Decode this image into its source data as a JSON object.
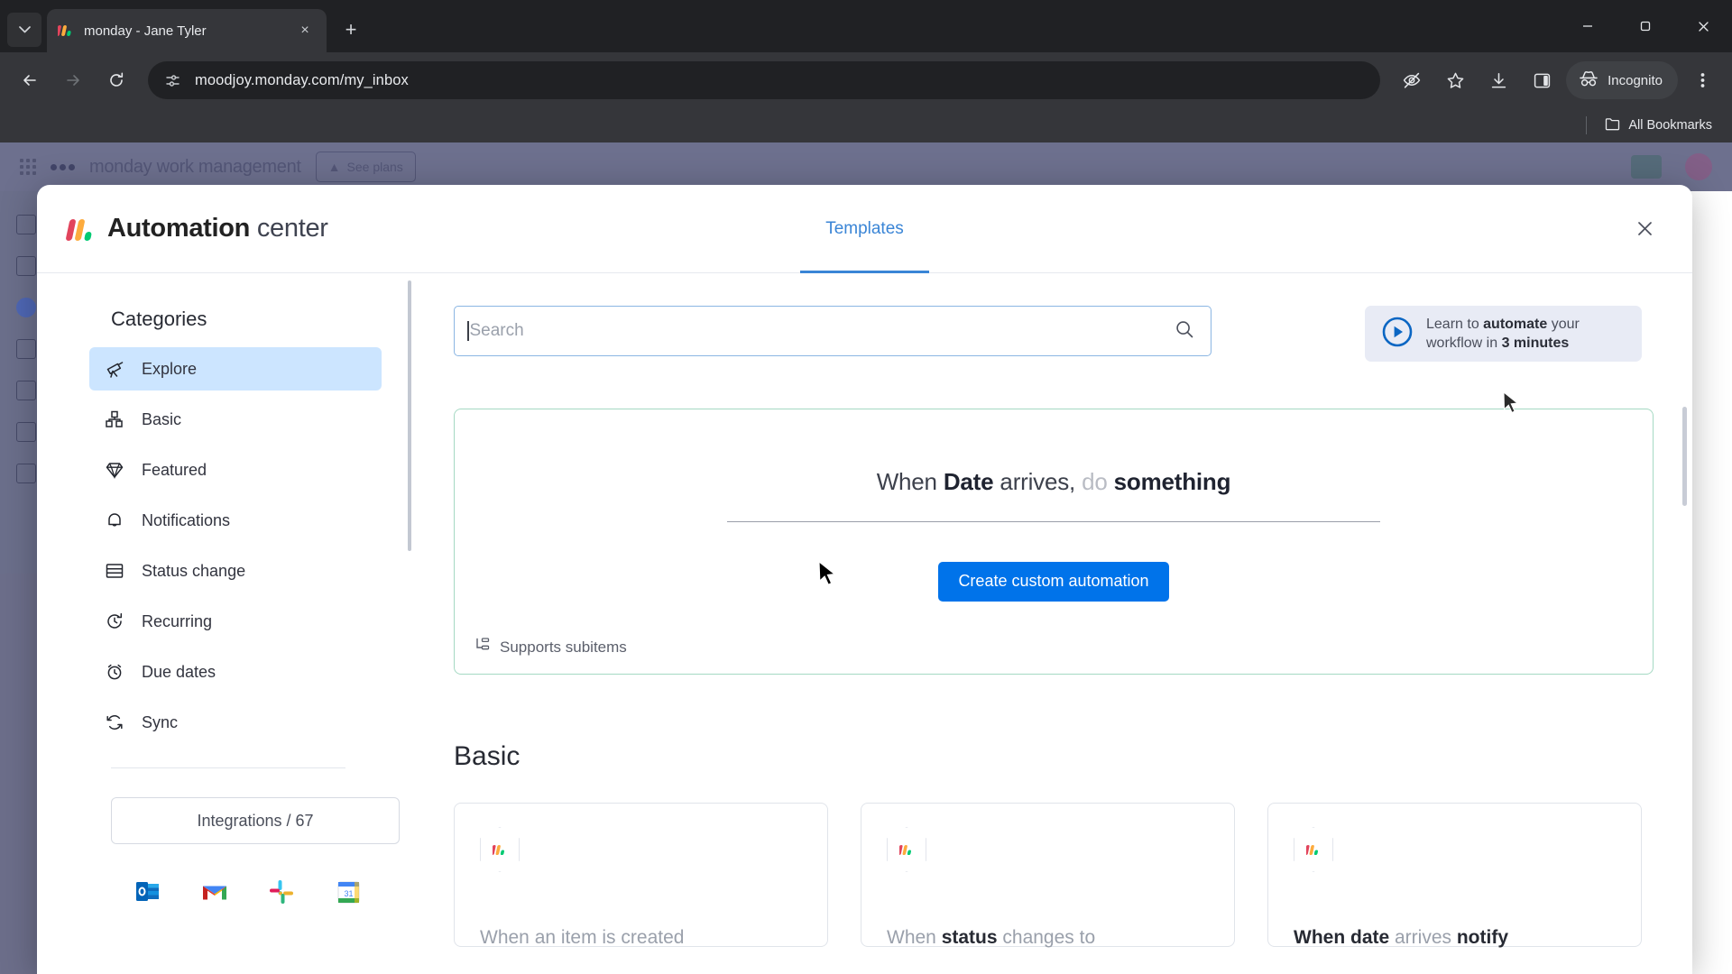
{
  "browser": {
    "tab": {
      "title": "monday - Jane Tyler",
      "favicon": "monday-logo-icon"
    },
    "tab_search_icon": "chevron-down-icon",
    "new_tab_label": "+",
    "close_tab_label": "×",
    "window": {
      "minimize": "–",
      "maximize": "❐",
      "close": "✕"
    },
    "nav": {
      "back": "←",
      "forward": "→",
      "reload": "↻"
    },
    "omnibox": {
      "url": "moodjoy.monday.com/my_inbox",
      "site_info_icon": "site-settings-icon"
    },
    "actions": {
      "tracking_protection": "eye-off-icon",
      "bookmark": "star-icon",
      "downloads": "download-icon",
      "side_panel": "side-panel-icon",
      "profile_label": "Incognito",
      "menu": "three-dot-menu-icon"
    },
    "bookmarks_bar": {
      "all_bookmarks": "All Bookmarks",
      "folder_icon": "folder-icon"
    }
  },
  "page_behind": {
    "brand": "monday",
    "brand_suffix": "work management",
    "see_plans": "See plans",
    "see_plans_icon": "rocket-icon"
  },
  "modal": {
    "brand_title": "Automation",
    "brand_subtitle": "center",
    "close_label": "✕",
    "tabs": [
      {
        "label": "Templates",
        "active": true
      }
    ]
  },
  "sidebar": {
    "title": "Categories",
    "items": [
      {
        "label": "Explore",
        "icon": "telescope-icon",
        "active": true
      },
      {
        "label": "Basic",
        "icon": "blocks-icon",
        "active": false
      },
      {
        "label": "Featured",
        "icon": "diamond-icon",
        "active": false
      },
      {
        "label": "Notifications",
        "icon": "bell-icon",
        "active": false
      },
      {
        "label": "Status change",
        "icon": "rows-icon",
        "active": false
      },
      {
        "label": "Recurring",
        "icon": "refresh-clock-icon",
        "active": false
      },
      {
        "label": "Due dates",
        "icon": "alarm-clock-icon",
        "active": false
      },
      {
        "label": "Sync",
        "icon": "sync-icon",
        "active": false
      }
    ],
    "integrations_label": "Integrations / 67",
    "apps": [
      {
        "name": "outlook-icon"
      },
      {
        "name": "gmail-icon"
      },
      {
        "name": "slack-icon"
      },
      {
        "name": "google-calendar-icon"
      }
    ]
  },
  "content": {
    "search": {
      "placeholder": "Search",
      "value": "",
      "icon": "search-icon"
    },
    "learn_banner": {
      "line1_pre": "Learn to ",
      "line1_bold": "automate",
      "line1_post": " your",
      "line2_pre": "workflow in ",
      "line2_bold": "3 minutes",
      "icon": "play-circle-icon"
    },
    "custom_card": {
      "recipe_when": "When ",
      "recipe_trigger": "Date",
      "recipe_mid": " arrives, ",
      "recipe_do": "do ",
      "recipe_action": "something",
      "button_label": "Create custom automation",
      "subitems_label": "Supports subitems",
      "subitems_icon": "subitems-icon"
    },
    "section_title": "Basic",
    "cards": [
      {
        "icon": "monday-hex-icon",
        "pre": "When an item is created",
        "bold": "",
        "post": ""
      },
      {
        "icon": "monday-hex-icon",
        "pre": "When ",
        "bold": "status",
        "post": " changes to"
      },
      {
        "icon": "monday-hex-icon",
        "pre": "When date",
        "bold": " arrives ",
        "post": "notify"
      }
    ]
  }
}
